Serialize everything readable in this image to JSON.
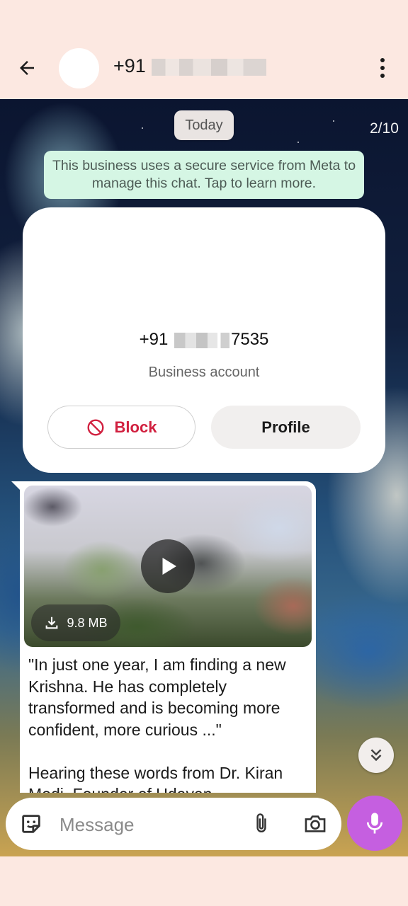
{
  "header": {
    "back_icon": "arrow-left-icon",
    "contact_name": "+91",
    "menu_icon": "kebab-menu-icon"
  },
  "chat": {
    "date_label": "Today",
    "page_counter": "2/10",
    "secure_notice": "This business uses a secure service from Meta to manage this chat. Tap to learn more.",
    "business_card": {
      "number_prefix": "+91",
      "number_suffix": "7535",
      "account_type": "Business account",
      "block_label": "Block",
      "profile_label": "Profile"
    },
    "message": {
      "video_size": "9.8 MB",
      "text": "\"In just one year, I am finding a new Krishna. He has completely transformed and is becoming more confident, more curious ...\"\n\nHearing these words from Dr. Kiran Modi, Founder of Udayan"
    }
  },
  "composer": {
    "placeholder": "Message"
  },
  "colors": {
    "header_bg": "#fce8e1",
    "block_red": "#d1203f",
    "mic_purple": "#c55fe0",
    "notice_green": "#d5f6e4"
  }
}
